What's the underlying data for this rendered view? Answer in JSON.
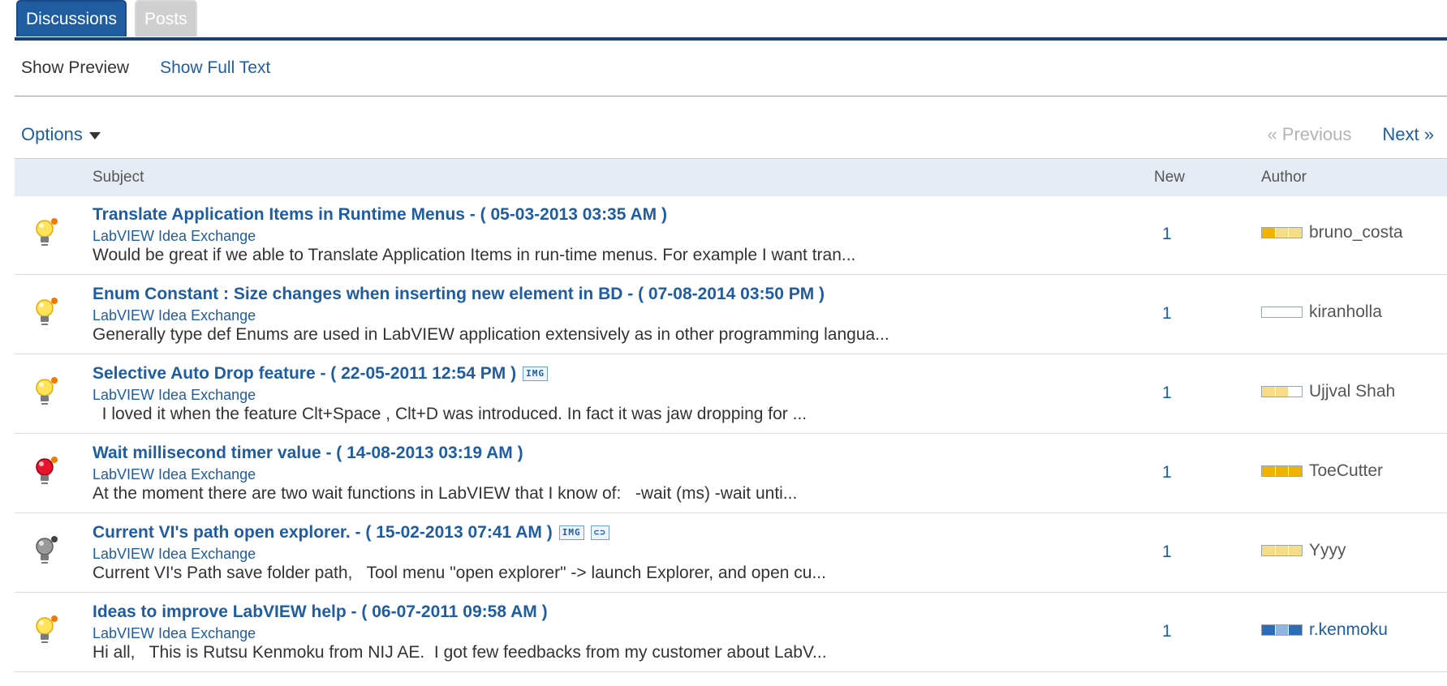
{
  "tabs": {
    "discussions": "Discussions",
    "posts": "Posts"
  },
  "view": {
    "preview": "Show Preview",
    "full_text": "Show Full Text"
  },
  "options_label": "Options",
  "pager": {
    "previous": "« Previous",
    "next": "Next »"
  },
  "columns": {
    "subject": "Subject",
    "new": "New",
    "author": "Author"
  },
  "colors": {
    "link": "#1f5da0",
    "rank_gold": "#f0b400",
    "rank_light": "#f7dc88",
    "rank_blue": "#2b6db6",
    "rank_lightblue": "#8fb4e0"
  },
  "rows": [
    {
      "icon": "idea-bulb-yellow-icon",
      "title": "Translate Application Items in Runtime Menus - ( 05-03-2013 03:35 AM )",
      "badges": [],
      "board": "LabVIEW Idea Exchange",
      "snippet": "Would be great if we able to Translate Application Items in run-time menus. For example I want tran...",
      "new": "1",
      "author": "bruno_costa",
      "rank": [
        "gold",
        "light",
        "light"
      ]
    },
    {
      "icon": "idea-bulb-yellow-icon",
      "title": "Enum Constant : Size changes when inserting new element in BD - ( 07-08-2014 03:50 PM )",
      "badges": [],
      "board": "LabVIEW Idea Exchange",
      "snippet": "Generally type def Enums are used in LabVIEW application extensively as in other programming langua...",
      "new": "1",
      "author": "kiranholla",
      "rank": [
        "empty",
        "empty",
        "empty"
      ]
    },
    {
      "icon": "idea-bulb-yellow-icon",
      "title": "Selective Auto Drop feature - ( 22-05-2011 12:54 PM )",
      "badges": [
        "IMG"
      ],
      "board": "LabVIEW Idea Exchange",
      "snippet": "  I loved it when the feature Clt+Space , Clt+D was introduced. In fact it was jaw dropping for ...",
      "new": "1",
      "author": "Ujjval Shah",
      "rank": [
        "light",
        "light",
        "empty"
      ]
    },
    {
      "icon": "idea-bulb-red-icon",
      "title": "Wait millisecond timer value - ( 14-08-2013 03:19 AM )",
      "badges": [],
      "board": "LabVIEW Idea Exchange",
      "snippet": "At the moment there are two wait functions in LabVIEW that I know of:   -wait (ms) -wait unti...",
      "new": "1",
      "author": "ToeCutter",
      "rank": [
        "gold",
        "gold",
        "gold"
      ]
    },
    {
      "icon": "idea-bulb-gray-icon",
      "title": "Current VI's path open explorer. - ( 15-02-2013 07:41 AM )",
      "badges": [
        "IMG",
        "ATTACH"
      ],
      "board": "LabVIEW Idea Exchange",
      "snippet": "Current VI's Path save folder path,   Tool menu \"open explorer\" -> launch Explorer, and open cu...",
      "new": "1",
      "author": "Yyyy",
      "rank": [
        "light",
        "light",
        "light"
      ]
    },
    {
      "icon": "idea-bulb-yellow-icon",
      "title": "Ideas to improve LabVIEW help - ( 06-07-2011 09:58 AM )",
      "badges": [],
      "board": "LabVIEW Idea Exchange",
      "snippet": "Hi all,   This is Rutsu Kenmoku from NIJ AE.  I got few feedbacks from my customer about LabV...",
      "new": "1",
      "author": "r.kenmoku",
      "rank": [
        "blue",
        "lightblue",
        "blue"
      ],
      "author_blue": true
    }
  ]
}
